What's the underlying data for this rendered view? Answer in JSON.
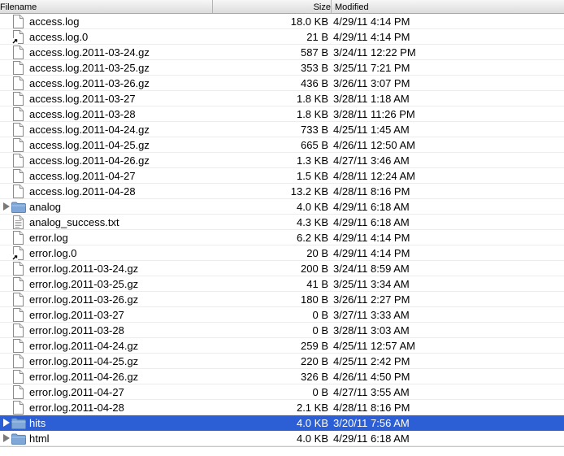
{
  "columns": {
    "filename": "Filename",
    "size": "Size",
    "modified": "Modified"
  },
  "files": [
    {
      "name": "access.log",
      "size": "18.0 KB",
      "modified": "4/29/11 4:14 PM",
      "kind": "file",
      "icon": "document-icon"
    },
    {
      "name": "access.log.0",
      "size": "21 B",
      "modified": "4/29/11 4:14 PM",
      "kind": "alias",
      "icon": "alias-icon"
    },
    {
      "name": "access.log.2011-03-24.gz",
      "size": "587 B",
      "modified": "3/24/11 12:22 PM",
      "kind": "file",
      "icon": "document-icon"
    },
    {
      "name": "access.log.2011-03-25.gz",
      "size": "353 B",
      "modified": "3/25/11 7:21 PM",
      "kind": "file",
      "icon": "document-icon"
    },
    {
      "name": "access.log.2011-03-26.gz",
      "size": "436 B",
      "modified": "3/26/11 3:07 PM",
      "kind": "file",
      "icon": "document-icon"
    },
    {
      "name": "access.log.2011-03-27",
      "size": "1.8 KB",
      "modified": "3/28/11 1:18 AM",
      "kind": "file",
      "icon": "document-icon"
    },
    {
      "name": "access.log.2011-03-28",
      "size": "1.8 KB",
      "modified": "3/28/11 11:26 PM",
      "kind": "file",
      "icon": "document-icon"
    },
    {
      "name": "access.log.2011-04-24.gz",
      "size": "733 B",
      "modified": "4/25/11 1:45 AM",
      "kind": "file",
      "icon": "document-icon"
    },
    {
      "name": "access.log.2011-04-25.gz",
      "size": "665 B",
      "modified": "4/26/11 12:50 AM",
      "kind": "file",
      "icon": "document-icon"
    },
    {
      "name": "access.log.2011-04-26.gz",
      "size": "1.3 KB",
      "modified": "4/27/11 3:46 AM",
      "kind": "file",
      "icon": "document-icon"
    },
    {
      "name": "access.log.2011-04-27",
      "size": "1.5 KB",
      "modified": "4/28/11 12:24 AM",
      "kind": "file",
      "icon": "document-icon"
    },
    {
      "name": "access.log.2011-04-28",
      "size": "13.2 KB",
      "modified": "4/28/11 8:16 PM",
      "kind": "file",
      "icon": "document-icon"
    },
    {
      "name": "analog",
      "size": "4.0 KB",
      "modified": "4/29/11 6:18 AM",
      "kind": "folder",
      "icon": "folder-icon"
    },
    {
      "name": "analog_success.txt",
      "size": "4.3 KB",
      "modified": "4/29/11 6:18 AM",
      "kind": "text",
      "icon": "text-document-icon"
    },
    {
      "name": "error.log",
      "size": "6.2 KB",
      "modified": "4/29/11 4:14 PM",
      "kind": "file",
      "icon": "document-icon"
    },
    {
      "name": "error.log.0",
      "size": "20 B",
      "modified": "4/29/11 4:14 PM",
      "kind": "alias",
      "icon": "alias-icon"
    },
    {
      "name": "error.log.2011-03-24.gz",
      "size": "200 B",
      "modified": "3/24/11 8:59 AM",
      "kind": "file",
      "icon": "document-icon"
    },
    {
      "name": "error.log.2011-03-25.gz",
      "size": "41 B",
      "modified": "3/25/11 3:34 AM",
      "kind": "file",
      "icon": "document-icon"
    },
    {
      "name": "error.log.2011-03-26.gz",
      "size": "180 B",
      "modified": "3/26/11 2:27 PM",
      "kind": "file",
      "icon": "document-icon"
    },
    {
      "name": "error.log.2011-03-27",
      "size": "0 B",
      "modified": "3/27/11 3:33 AM",
      "kind": "file",
      "icon": "document-icon"
    },
    {
      "name": "error.log.2011-03-28",
      "size": "0 B",
      "modified": "3/28/11 3:03 AM",
      "kind": "file",
      "icon": "document-icon"
    },
    {
      "name": "error.log.2011-04-24.gz",
      "size": "259 B",
      "modified": "4/25/11 12:57 AM",
      "kind": "file",
      "icon": "document-icon"
    },
    {
      "name": "error.log.2011-04-25.gz",
      "size": "220 B",
      "modified": "4/25/11 2:42 PM",
      "kind": "file",
      "icon": "document-icon"
    },
    {
      "name": "error.log.2011-04-26.gz",
      "size": "326 B",
      "modified": "4/26/11 4:50 PM",
      "kind": "file",
      "icon": "document-icon"
    },
    {
      "name": "error.log.2011-04-27",
      "size": "0 B",
      "modified": "4/27/11 3:55 AM",
      "kind": "file",
      "icon": "document-icon"
    },
    {
      "name": "error.log.2011-04-28",
      "size": "2.1 KB",
      "modified": "4/28/11 8:16 PM",
      "kind": "file",
      "icon": "document-icon"
    },
    {
      "name": "hits",
      "size": "4.0 KB",
      "modified": "3/20/11 7:56 AM",
      "kind": "folder",
      "icon": "folder-icon",
      "selected": true
    },
    {
      "name": "html",
      "size": "4.0 KB",
      "modified": "4/29/11 6:18 AM",
      "kind": "folder",
      "icon": "folder-icon"
    }
  ],
  "colors": {
    "selection": "#2c5fd6",
    "folder": "#7fa8d8"
  }
}
